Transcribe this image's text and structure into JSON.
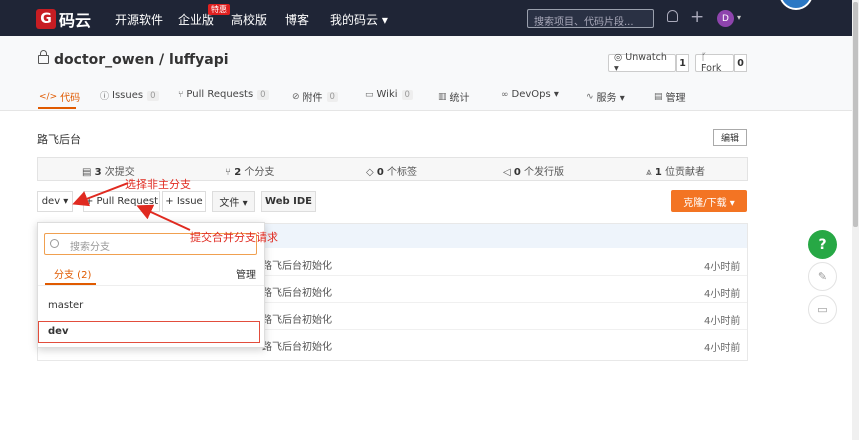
{
  "nav": {
    "logo_mark": "G",
    "logo_text": "码云",
    "items": [
      "开源软件",
      "企业版",
      "高校版",
      "博客",
      "我的码云 ▾"
    ],
    "hot_badge": "特惠",
    "search_placeholder": "搜索项目、代码片段...",
    "avatar_letter": "D",
    "avatar_caret": "▾"
  },
  "repo": {
    "title": "doctor_owen / luffyapi",
    "unwatch_label": "◎ Unwatch ▾",
    "unwatch_count": "1",
    "fork_label": "ᚴ Fork",
    "fork_count": "0"
  },
  "tabs": [
    {
      "label": "代码",
      "count": ""
    },
    {
      "label": "Issues",
      "count": "0"
    },
    {
      "label": "Pull Requests",
      "count": "0"
    },
    {
      "label": "附件",
      "count": "0"
    },
    {
      "label": "Wiki",
      "count": "0"
    },
    {
      "label": "统计",
      "count": ""
    },
    {
      "label": "DevOps ▾",
      "count": ""
    },
    {
      "label": "服务 ▾",
      "count": ""
    },
    {
      "label": "管理",
      "count": ""
    }
  ],
  "main": {
    "description": "路飞后台",
    "edit_label": "编辑",
    "stats": [
      {
        "num": "3",
        "text": "次提交"
      },
      {
        "num": "2",
        "text": "个分支"
      },
      {
        "num": "0",
        "text": "个标签"
      },
      {
        "num": "0",
        "text": "个发行版"
      },
      {
        "num": "1",
        "text": "位贡献者"
      }
    ],
    "branch_label": "dev ▾",
    "pull_request_label": "+ Pull Request",
    "issue_label": "+ Issue",
    "file_label": "文件 ▾",
    "webide_label": "Web IDE",
    "clone_label": "克隆/下载 ▾",
    "files": [
      {
        "msg": "路飞后台初始化",
        "time": "4小时前"
      },
      {
        "msg": "路飞后台初始化",
        "time": "4小时前"
      },
      {
        "msg": "路飞后台初始化",
        "time": "4小时前"
      },
      {
        "msg": "路飞后台初始化",
        "time": "4小时前"
      }
    ]
  },
  "dropdown": {
    "search_placeholder": "搜索分支",
    "tab_label": "分支 (2)",
    "manage_label": "管理",
    "branches": [
      "master",
      "dev"
    ]
  },
  "annotations": {
    "branch_note": "选择非主分支",
    "pr_note": "提交合并分支请求"
  },
  "floating": {
    "help": "?"
  },
  "colors": {
    "nav_bg": "#1f2536",
    "accent": "#e05a00",
    "clone_bg": "#f37423",
    "help_bg": "#27a845",
    "annotation": "#e02a20"
  }
}
